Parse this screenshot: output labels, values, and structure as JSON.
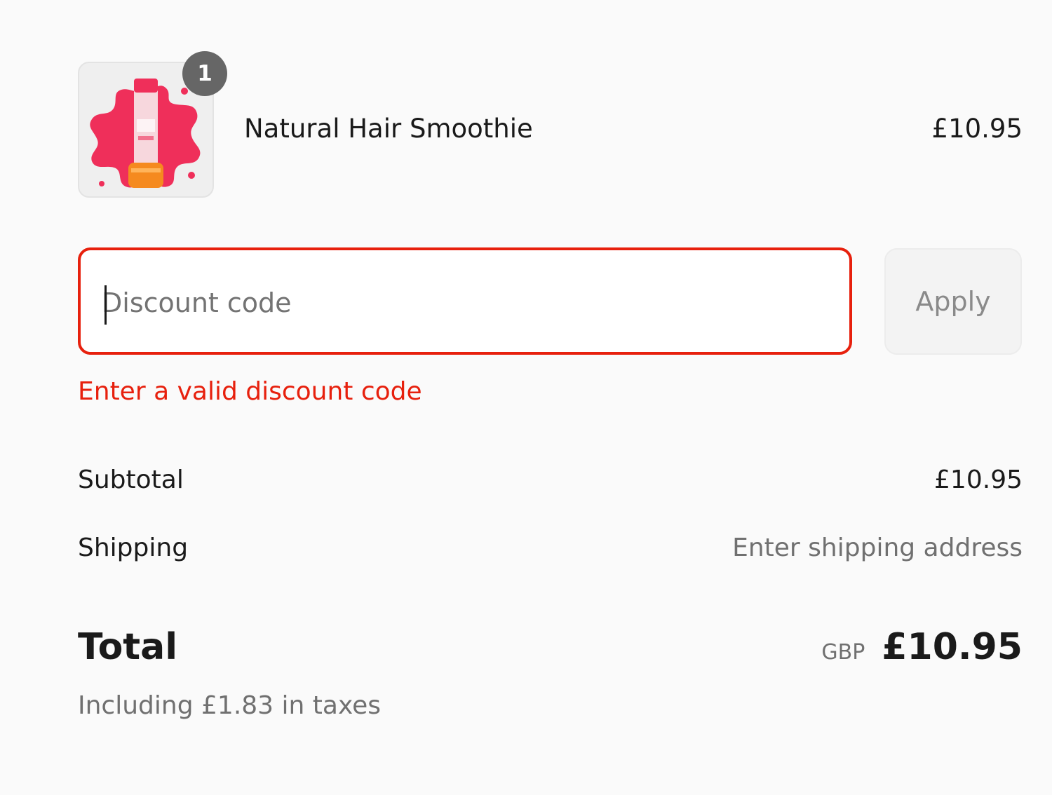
{
  "line_item": {
    "quantity": "1",
    "name": "Natural Hair Smoothie",
    "price": "£10.95",
    "thumbnail_icon": "product-thumbnail",
    "thumbnail_colors": [
      "#ef2f5a",
      "#f58a1f"
    ]
  },
  "discount": {
    "placeholder": "Discount code",
    "value": "",
    "apply_label": "Apply",
    "error": "Enter a valid discount code",
    "error_color": "#e7200d"
  },
  "totals": {
    "subtotal_label": "Subtotal",
    "subtotal_value": "£10.95",
    "shipping_label": "Shipping",
    "shipping_value": "Enter shipping address",
    "total_label": "Total",
    "currency_code": "GBP",
    "total_value": "£10.95",
    "taxes_note": "Including £1.83 in taxes"
  }
}
